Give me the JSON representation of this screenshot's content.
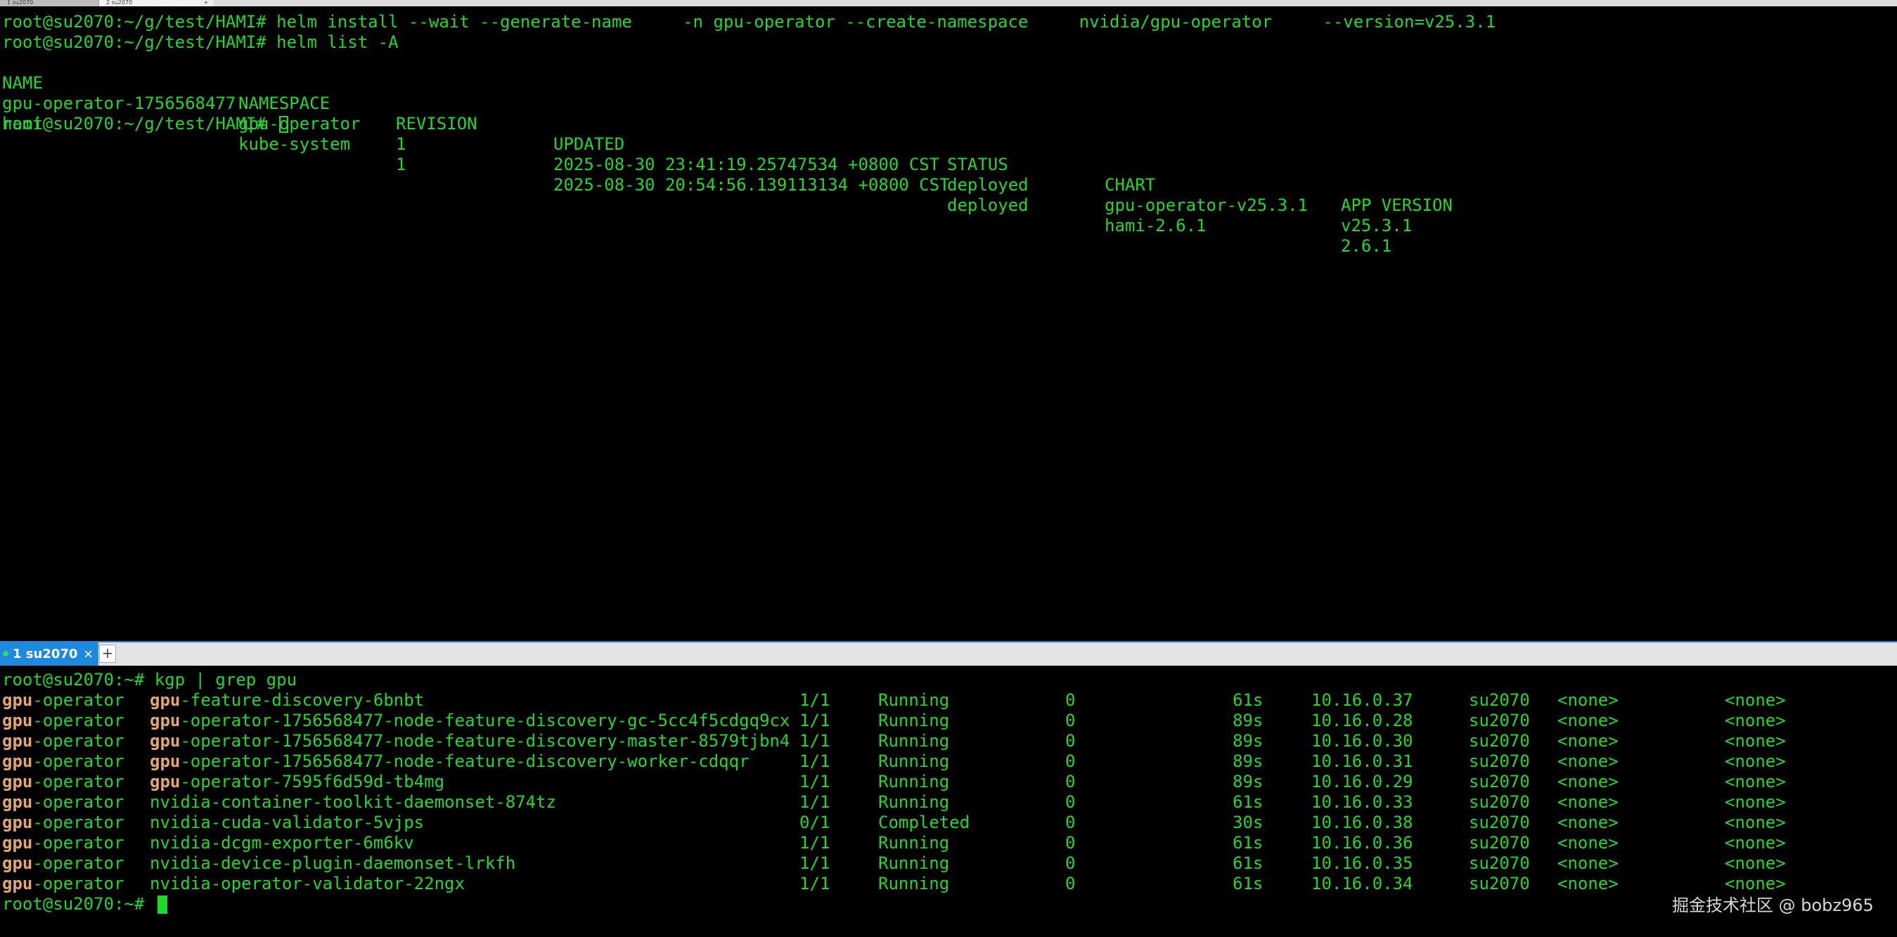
{
  "top_tabbar": {
    "tabs": [
      {
        "label": "1 su2070"
      },
      {
        "label": "2 su2070"
      }
    ],
    "add_label": "+"
  },
  "top_pane": {
    "lines": [
      "root@su2070:~/g/test/HAMI# helm install --wait --generate-name     -n gpu-operator --create-namespace     nvidia/gpu-operator     --version=v25.3.1",
      "root@su2070:~/g/test/HAMI# helm list -A"
    ],
    "helm_headers": [
      "NAME",
      "NAMESPACE",
      "REVISION",
      "UPDATED",
      "STATUS",
      "CHART",
      "APP VERSION"
    ],
    "helm_rows": [
      [
        "gpu-operator-1756568477",
        "gpu-operator",
        "1",
        "2025-08-30 23:41:19.25747534 +0800 CST",
        "deployed",
        "gpu-operator-v25.3.1",
        "v25.3.1"
      ],
      [
        "hami",
        "kube-system",
        "1",
        "2025-08-30 20:54:56.139113134 +0800 CST",
        "deployed",
        "hami-2.6.1",
        "2.6.1"
      ]
    ],
    "final_prompt": "root@su2070:~/g/test/HAMI# "
  },
  "bottom_tabbar": {
    "active_tab": "1 su2070",
    "close_label": "×",
    "add_label": "+"
  },
  "bottom_pane": {
    "command_line": "root@su2070:~# kgp | grep gpu",
    "highlight": "gpu",
    "pods": [
      {
        "ns_hl": "gpu",
        "ns_rest": "-operator",
        "name_hl": "gpu",
        "name_rest": "-feature-discovery-6bnbt",
        "ready": "1/1",
        "status": "Running",
        "restarts": "0",
        "age": "61s",
        "ip": "10.16.0.37",
        "node": "su2070",
        "nominated": "<none>",
        "readiness": "<none>"
      },
      {
        "ns_hl": "gpu",
        "ns_rest": "-operator",
        "name_hl": "gpu",
        "name_rest": "-operator-1756568477-node-feature-discovery-gc-5cc4f5cdgq9cx",
        "ready": "1/1",
        "status": "Running",
        "restarts": "0",
        "age": "89s",
        "ip": "10.16.0.28",
        "node": "su2070",
        "nominated": "<none>",
        "readiness": "<none>"
      },
      {
        "ns_hl": "gpu",
        "ns_rest": "-operator",
        "name_hl": "gpu",
        "name_rest": "-operator-1756568477-node-feature-discovery-master-8579tjbn4",
        "ready": "1/1",
        "status": "Running",
        "restarts": "0",
        "age": "89s",
        "ip": "10.16.0.30",
        "node": "su2070",
        "nominated": "<none>",
        "readiness": "<none>"
      },
      {
        "ns_hl": "gpu",
        "ns_rest": "-operator",
        "name_hl": "gpu",
        "name_rest": "-operator-1756568477-node-feature-discovery-worker-cdqqr",
        "ready": "1/1",
        "status": "Running",
        "restarts": "0",
        "age": "89s",
        "ip": "10.16.0.31",
        "node": "su2070",
        "nominated": "<none>",
        "readiness": "<none>"
      },
      {
        "ns_hl": "gpu",
        "ns_rest": "-operator",
        "name_hl": "gpu",
        "name_rest": "-operator-7595f6d59d-tb4mg",
        "ready": "1/1",
        "status": "Running",
        "restarts": "0",
        "age": "89s",
        "ip": "10.16.0.29",
        "node": "su2070",
        "nominated": "<none>",
        "readiness": "<none>"
      },
      {
        "ns_hl": "gpu",
        "ns_rest": "-operator",
        "name_hl": "",
        "name_rest": "nvidia-container-toolkit-daemonset-874tz",
        "ready": "1/1",
        "status": "Running",
        "restarts": "0",
        "age": "61s",
        "ip": "10.16.0.33",
        "node": "su2070",
        "nominated": "<none>",
        "readiness": "<none>"
      },
      {
        "ns_hl": "gpu",
        "ns_rest": "-operator",
        "name_hl": "",
        "name_rest": "nvidia-cuda-validator-5vjps",
        "ready": "0/1",
        "status": "Completed",
        "restarts": "0",
        "age": "30s",
        "ip": "10.16.0.38",
        "node": "su2070",
        "nominated": "<none>",
        "readiness": "<none>"
      },
      {
        "ns_hl": "gpu",
        "ns_rest": "-operator",
        "name_hl": "",
        "name_rest": "nvidia-dcgm-exporter-6m6kv",
        "ready": "1/1",
        "status": "Running",
        "restarts": "0",
        "age": "61s",
        "ip": "10.16.0.36",
        "node": "su2070",
        "nominated": "<none>",
        "readiness": "<none>"
      },
      {
        "ns_hl": "gpu",
        "ns_rest": "-operator",
        "name_hl": "",
        "name_rest": "nvidia-device-plugin-daemonset-lrkfh",
        "ready": "1/1",
        "status": "Running",
        "restarts": "0",
        "age": "61s",
        "ip": "10.16.0.35",
        "node": "su2070",
        "nominated": "<none>",
        "readiness": "<none>"
      },
      {
        "ns_hl": "gpu",
        "ns_rest": "-operator",
        "name_hl": "",
        "name_rest": "nvidia-operator-validator-22ngx",
        "ready": "1/1",
        "status": "Running",
        "restarts": "0",
        "age": "61s",
        "ip": "10.16.0.34",
        "node": "su2070",
        "nominated": "<none>",
        "readiness": "<none>"
      }
    ],
    "final_prompt": "root@su2070:~# "
  },
  "watermark": "掘金技术社区 @ bobz965",
  "colors": {
    "terminal_text": "#1fd829",
    "highlight": "#e6a66b",
    "active_tab": "#1e8adf",
    "background": "#000000"
  }
}
